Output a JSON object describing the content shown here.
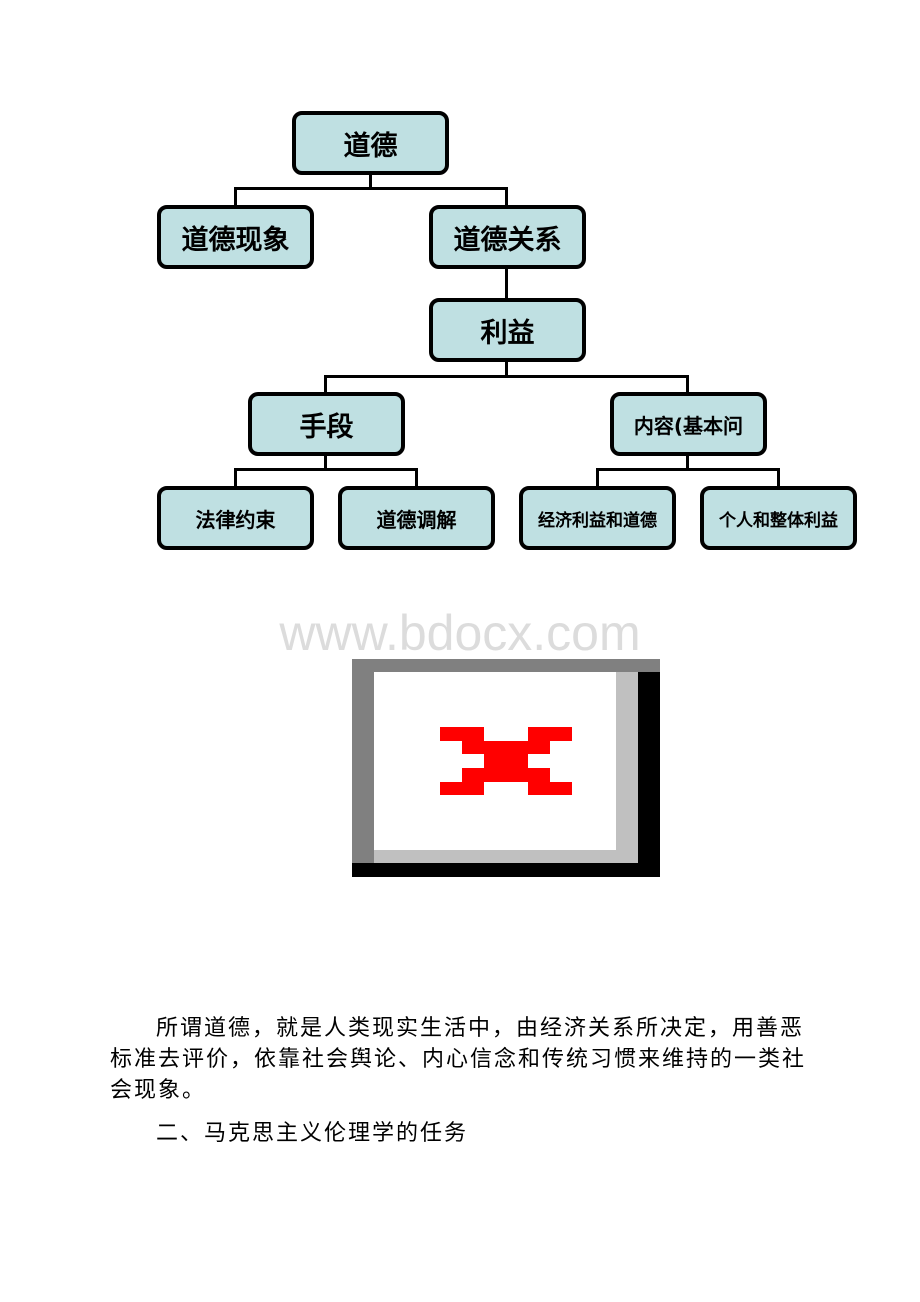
{
  "diagram": {
    "root": "道德",
    "level1": [
      "道德现象",
      "道德关系"
    ],
    "interest": "利益",
    "level3": [
      "手段",
      "内容(基本问"
    ],
    "means_children": [
      "法律约束",
      "道德调解"
    ],
    "content_children": [
      "经济利益和道德",
      "个人和整体利益"
    ],
    "node_fill": "#bfe0e2"
  },
  "watermark": "www.bdocx.com",
  "broken_image": {
    "icon": "broken-image-icon",
    "x_color": "#ff0000"
  },
  "body": {
    "definition": "所谓道德，就是人类现实生活中，由经济关系所决定，用善恶标准去评价，依靠社会舆论、内心信念和传统习惯来维持的一类社会现象。",
    "heading": "二、马克思主义伦理学的任务"
  }
}
